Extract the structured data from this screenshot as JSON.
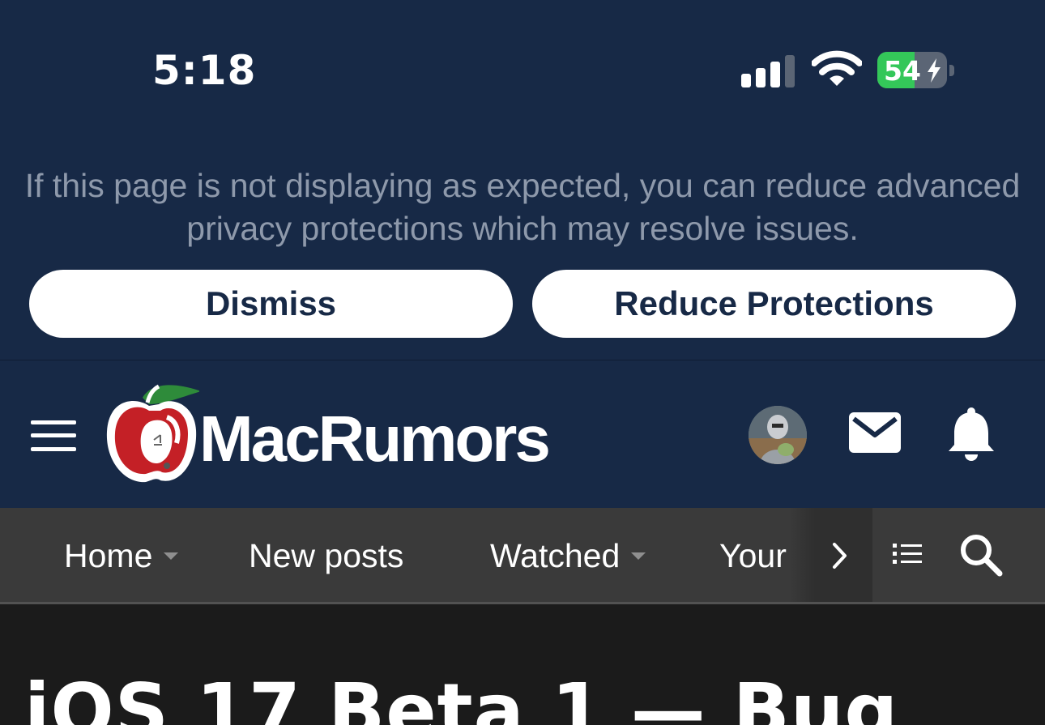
{
  "status_bar": {
    "time": "5:18",
    "battery_percent": "54",
    "battery_level": 0.54,
    "charging": true,
    "icons": [
      "cellular-signal-icon",
      "wifi-icon",
      "battery-icon"
    ]
  },
  "privacy_banner": {
    "message": "If this page is not displaying as expected, you can reduce advanced privacy protections which may resolve issues.",
    "dismiss_label": "Dismiss",
    "reduce_label": "Reduce Protections"
  },
  "header": {
    "brand": "MacRumors",
    "icons": [
      "menu-icon",
      "macrumors-apple-logo",
      "avatar",
      "mail-icon",
      "bell-icon"
    ]
  },
  "nav": {
    "items": [
      {
        "label": "Home",
        "dropdown": true
      },
      {
        "label": "New posts",
        "dropdown": false
      },
      {
        "label": "Watched",
        "dropdown": true
      },
      {
        "label": "Your",
        "dropdown": false
      }
    ],
    "icons": [
      "chevron-right-icon",
      "list-icon",
      "search-icon"
    ]
  },
  "article": {
    "title": "iOS 17 Beta 1 — Bug"
  },
  "colors": {
    "banner_bg": "#172946",
    "banner_text": "#8e99ab",
    "nav_bg": "#3a3a3a",
    "page_bg": "#1b1b1b",
    "battery_green": "#34c759"
  }
}
